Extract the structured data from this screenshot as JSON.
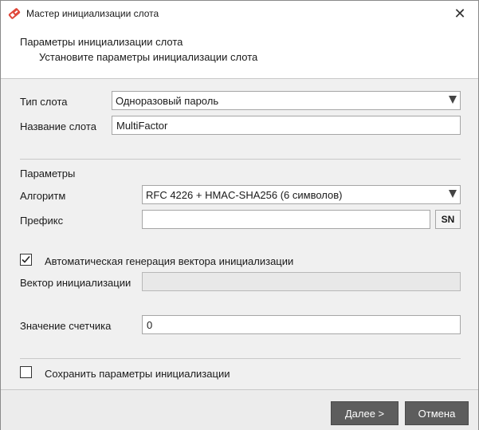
{
  "window": {
    "title": "Мастер инициализации слота",
    "close_glyph": "✕",
    "icon_color": "#e0473a"
  },
  "header": {
    "title": "Параметры инициализации слота",
    "subtitle": "Установите параметры инициализации слота"
  },
  "slot": {
    "type_label": "Тип слота",
    "type_value": "Одноразовый пароль",
    "name_label": "Название слота",
    "name_value": "MultiFactor"
  },
  "params": {
    "section_label": "Параметры",
    "algorithm_label": "Алгоритм",
    "algorithm_value": "RFC 4226 + HMAC-SHA256 (6 символов)",
    "prefix_label": "Префикс",
    "prefix_value": "",
    "sn_button": "SN",
    "auto_iv_label": "Автоматическая генерация вектора инициализации",
    "auto_iv_checked": true,
    "iv_label": "Вектор инициализации",
    "iv_value": "",
    "counter_label": "Значение счетчика",
    "counter_value": "0",
    "save_params_label": "Сохранить параметры инициализации",
    "save_params_checked": false
  },
  "footer": {
    "next_button": "Далее >",
    "cancel_button": "Отмена",
    "button_color": "#5d5d5d"
  }
}
